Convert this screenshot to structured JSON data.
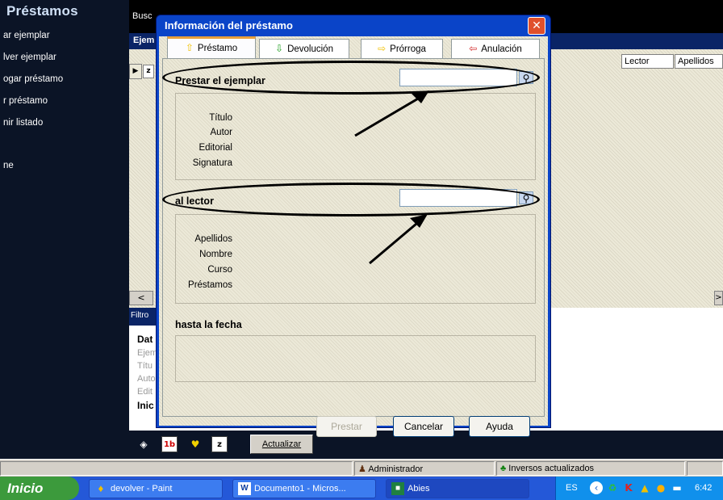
{
  "app": {
    "title": "Préstamos"
  },
  "sidebar": {
    "items": [
      {
        "label": "ar ejemplar"
      },
      {
        "label": "lver ejemplar"
      },
      {
        "label": "ogar préstamo"
      },
      {
        "label": "r préstamo"
      },
      {
        "label": "nir listado"
      },
      {
        "label": "ne"
      }
    ]
  },
  "background": {
    "busc_label": "Busc",
    "ejem_label": "Ejem",
    "columns": [
      "Lector",
      "Apellidos"
    ],
    "filter_label": "Filtro",
    "filter_rows": [
      "Dat",
      "Ejem",
      "Títu",
      "Auto",
      "Edit",
      "Inic"
    ]
  },
  "toolbar": {
    "actualizar_label": "Actualizar"
  },
  "dialog": {
    "title": "Información del préstamo",
    "close_icon": "close-icon",
    "tabs": [
      {
        "label": "Préstamo",
        "icon": "arrow-up-icon",
        "color": "#f0c000"
      },
      {
        "label": "Devolución",
        "icon": "arrow-down-icon",
        "color": "#20a020"
      },
      {
        "label": "Prórroga",
        "icon": "arrow-right-icon",
        "color": "#f0c000"
      },
      {
        "label": "Anulación",
        "icon": "arrow-left-icon",
        "color": "#d02020"
      }
    ],
    "ejemplar": {
      "label": "Prestar el ejemplar",
      "value": "",
      "fields": [
        "Título",
        "Autor",
        "Editorial",
        "Signatura"
      ]
    },
    "lector": {
      "label": "al lector",
      "value": "",
      "fields": [
        "Apellidos",
        "Nombre",
        "Curso",
        "Préstamos"
      ]
    },
    "fecha": {
      "label": "hasta la fecha"
    },
    "buttons": {
      "prestar": "Prestar",
      "cancelar": "Cancelar",
      "ayuda": "Ayuda"
    }
  },
  "statusbar": {
    "user": "Administrador",
    "message": "Inversos actualizados"
  },
  "taskbar": {
    "start_label": "Inicio",
    "tasks": [
      {
        "label": "devolver - Paint",
        "icon": "paint-icon"
      },
      {
        "label": "Documento1 - Micros...",
        "icon": "word-icon"
      },
      {
        "label": "Abies",
        "icon": "abies-icon"
      }
    ],
    "lang": "ES",
    "clock": "6:42"
  }
}
